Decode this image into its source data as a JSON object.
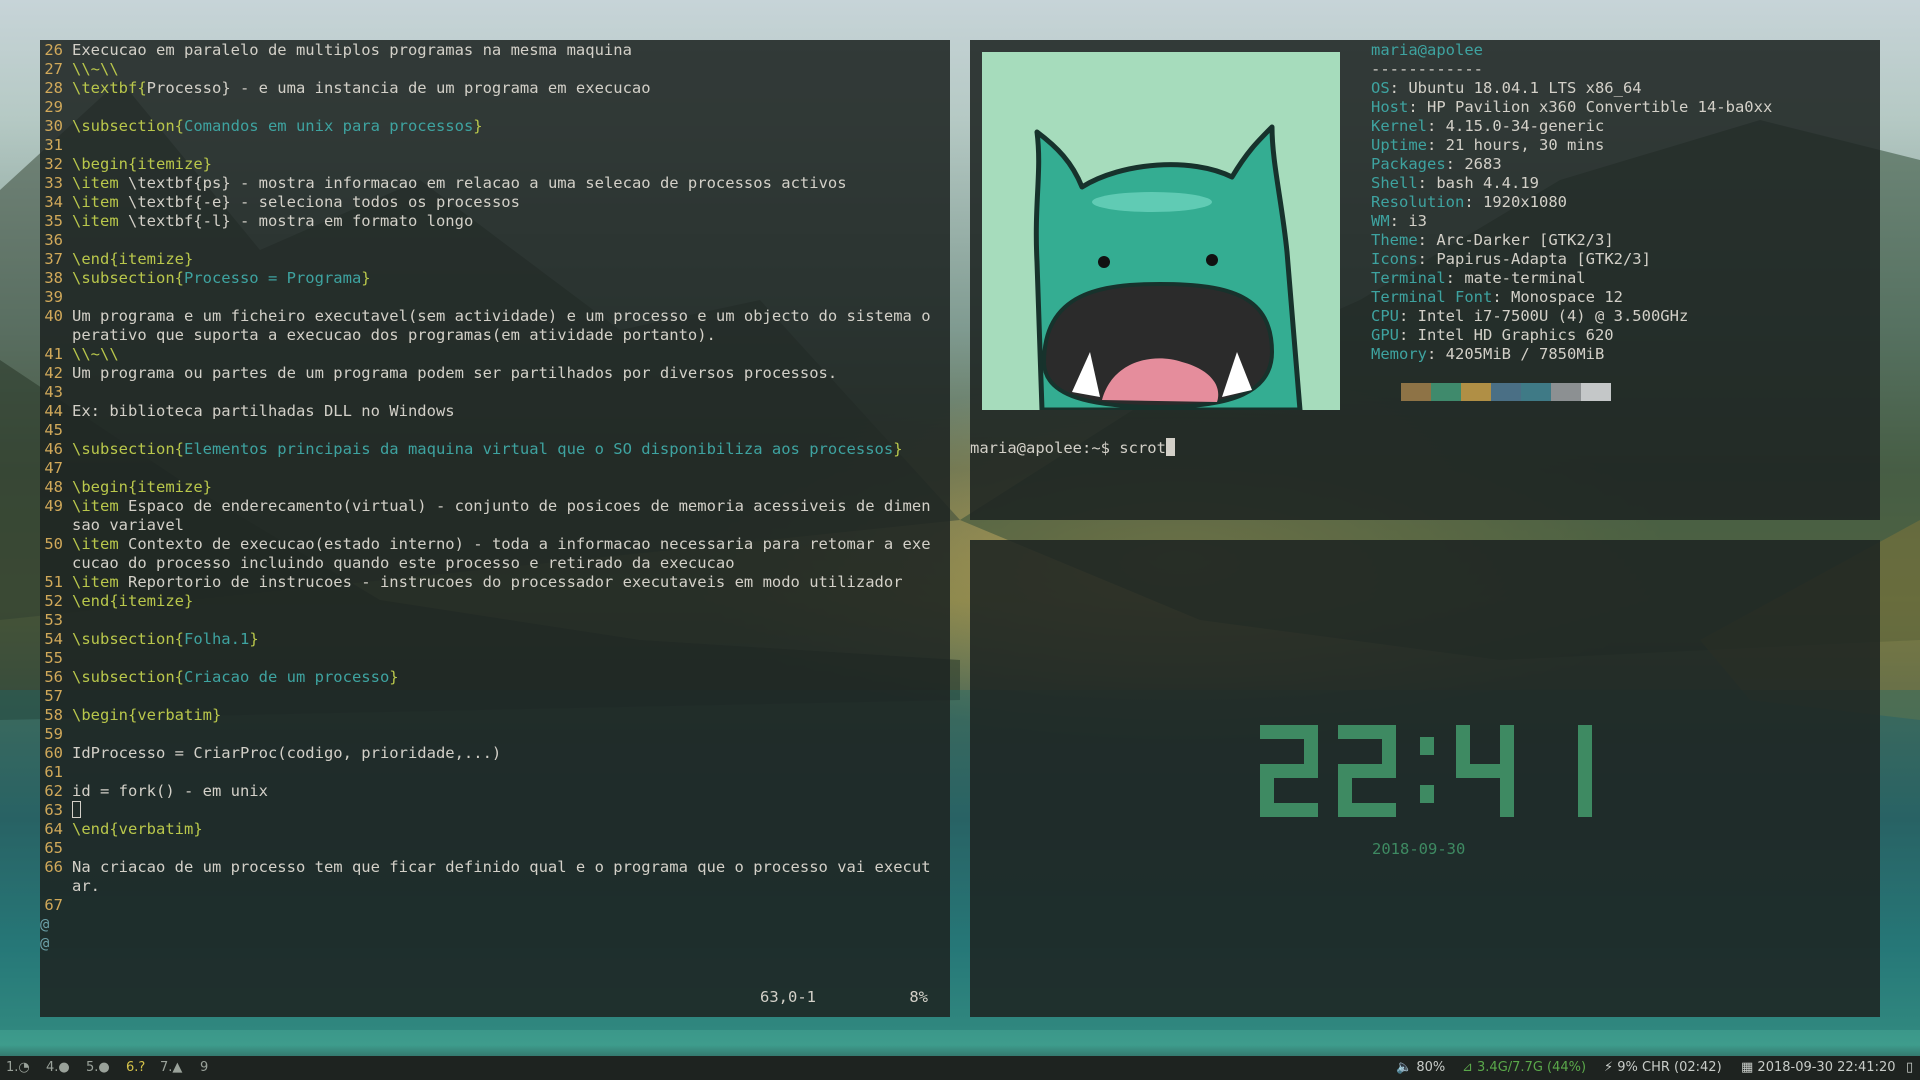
{
  "vim": {
    "lines": [
      {
        "n": "26",
        "t": "Execucao em paralelo de multiplos programas na mesma maquina"
      },
      {
        "n": "27",
        "t": "\\\\~\\\\",
        "cls": "kw"
      },
      {
        "n": "28",
        "parts": [
          [
            "\\textbf{",
            "kw"
          ],
          [
            "Processo",
            ""
          ],
          [
            "} - e uma instancia de um programa em execucao",
            ""
          ]
        ]
      },
      {
        "n": "29",
        "t": ""
      },
      {
        "n": "30",
        "parts": [
          [
            "\\subsection{",
            "kw"
          ],
          [
            "Comandos em unix para processos",
            "sec"
          ],
          [
            "}",
            "kw"
          ]
        ]
      },
      {
        "n": "31",
        "t": ""
      },
      {
        "n": "32",
        "parts": [
          [
            "\\begin{",
            "kw"
          ],
          [
            "itemize",
            "cmd"
          ],
          [
            "}",
            "kw"
          ]
        ]
      },
      {
        "n": "33",
        "parts": [
          [
            "\\item",
            "kw"
          ],
          [
            " \\textbf{",
            ""
          ],
          [
            "ps",
            ""
          ],
          [
            "} - mostra informacao em relacao a uma selecao de processos activos",
            ""
          ]
        ]
      },
      {
        "n": "34",
        "parts": [
          [
            "\\item",
            "kw"
          ],
          [
            " \\textbf{-e} - seleciona todos os processos",
            ""
          ]
        ]
      },
      {
        "n": "35",
        "parts": [
          [
            "\\item",
            "kw"
          ],
          [
            " \\textbf{-l} - mostra em formato longo",
            ""
          ]
        ]
      },
      {
        "n": "36",
        "t": ""
      },
      {
        "n": "37",
        "parts": [
          [
            "\\end{",
            "kw"
          ],
          [
            "itemize",
            "cmd"
          ],
          [
            "}",
            "kw"
          ]
        ]
      },
      {
        "n": "38",
        "parts": [
          [
            "\\subsection{",
            "kw"
          ],
          [
            "Processo = Programa",
            "sec"
          ],
          [
            "}",
            "kw"
          ]
        ]
      },
      {
        "n": "39",
        "t": ""
      },
      {
        "n": "40",
        "t": "Um programa e um ficheiro executavel(sem actividade) e um processo e um objecto do sistema operativo que suporta a execucao dos programas(em atividade portanto)."
      },
      {
        "n": "41",
        "t": "\\\\~\\\\",
        "cls": "kw"
      },
      {
        "n": "42",
        "t": "Um programa ou partes de um programa podem ser partilhados por diversos processos."
      },
      {
        "n": "43",
        "t": ""
      },
      {
        "n": "44",
        "t": "Ex: biblioteca partilhadas DLL no Windows"
      },
      {
        "n": "45",
        "t": ""
      },
      {
        "n": "46",
        "parts": [
          [
            "\\subsection{",
            "kw"
          ],
          [
            "Elementos principais da maquina virtual que o SO disponibiliza aos processos",
            "sec"
          ],
          [
            "}",
            "kw"
          ]
        ]
      },
      {
        "n": "47",
        "t": ""
      },
      {
        "n": "48",
        "parts": [
          [
            "\\begin{",
            "kw"
          ],
          [
            "itemize",
            "cmd"
          ],
          [
            "}",
            "kw"
          ]
        ]
      },
      {
        "n": "49",
        "parts": [
          [
            "\\item",
            "kw"
          ],
          [
            " Espaco de enderecamento(virtual) - conjunto de posicoes de memoria acessiveis de dimensao variavel",
            ""
          ]
        ]
      },
      {
        "n": "50",
        "parts": [
          [
            "\\item",
            "kw"
          ],
          [
            " Contexto de execucao(estado interno) - toda a informacao necessaria para retomar a execucao do processo incluindo quando este processo e retirado da execucao",
            ""
          ]
        ]
      },
      {
        "n": "51",
        "parts": [
          [
            "\\item",
            "kw"
          ],
          [
            " Reportorio de instrucoes - instrucoes do processador executaveis em modo utilizador",
            ""
          ]
        ]
      },
      {
        "n": "52",
        "parts": [
          [
            "\\end{",
            "kw"
          ],
          [
            "itemize",
            "cmd"
          ],
          [
            "}",
            "kw"
          ]
        ]
      },
      {
        "n": "53",
        "t": ""
      },
      {
        "n": "54",
        "parts": [
          [
            "\\subsection{",
            "kw"
          ],
          [
            "Folha.1",
            "sec"
          ],
          [
            "}",
            "kw"
          ]
        ]
      },
      {
        "n": "55",
        "t": ""
      },
      {
        "n": "56",
        "parts": [
          [
            "\\subsection{",
            "kw"
          ],
          [
            "Criacao de um processo",
            "sec"
          ],
          [
            "}",
            "kw"
          ]
        ]
      },
      {
        "n": "57",
        "t": ""
      },
      {
        "n": "58",
        "parts": [
          [
            "\\begin{",
            "kw"
          ],
          [
            "verbatim",
            "cmd"
          ],
          [
            "}",
            "kw"
          ]
        ]
      },
      {
        "n": "59",
        "t": ""
      },
      {
        "n": "60",
        "t": "IdProcesso = CriarProc(codigo, prioridade,...)"
      },
      {
        "n": "61",
        "t": ""
      },
      {
        "n": "62",
        "t": "id = fork() - em unix"
      },
      {
        "n": "63",
        "t": "",
        "cursor": true
      },
      {
        "n": "64",
        "parts": [
          [
            "\\end{",
            "kw"
          ],
          [
            "verbatim",
            "cmd"
          ],
          [
            "}",
            "kw"
          ]
        ]
      },
      {
        "n": "65",
        "t": ""
      },
      {
        "n": "66",
        "t": "Na criacao de um processo tem que ficar definido qual e o programa que o processo vai executar."
      },
      {
        "n": "67",
        "t": ""
      }
    ],
    "tildes": [
      "@",
      "@"
    ],
    "status_pos": "63,0-1",
    "status_pct": "8%"
  },
  "neofetch": {
    "user_host": "maria@apolee",
    "separator": "------------",
    "fields": [
      {
        "k": "OS",
        "v": "Ubuntu 18.04.1 LTS x86_64"
      },
      {
        "k": "Host",
        "v": "HP Pavilion x360 Convertible 14-ba0xx"
      },
      {
        "k": "Kernel",
        "v": "4.15.0-34-generic"
      },
      {
        "k": "Uptime",
        "v": "21 hours, 30 mins"
      },
      {
        "k": "Packages",
        "v": "2683"
      },
      {
        "k": "Shell",
        "v": "bash 4.4.19"
      },
      {
        "k": "Resolution",
        "v": "1920x1080"
      },
      {
        "k": "WM",
        "v": "i3"
      },
      {
        "k": "Theme",
        "v": "Arc-Darker [GTK2/3]"
      },
      {
        "k": "Icons",
        "v": "Papirus-Adapta [GTK2/3]"
      },
      {
        "k": "Terminal",
        "v": "mate-terminal"
      },
      {
        "k": "Terminal Font",
        "v": "Monospace 12"
      },
      {
        "k": "CPU",
        "v": "Intel i7-7500U (4) @ 3.500GHz"
      },
      {
        "k": "GPU",
        "v": "Intel HD Graphics 620"
      },
      {
        "k": "Memory",
        "v": "4205MiB / 7850MiB"
      }
    ],
    "palette": [
      "#8e7346",
      "#3f8a6c",
      "#b08f45",
      "#4a6f85",
      "#3f7a86",
      "#8c9092",
      "#c4c7c8"
    ],
    "prompt": "maria@apolee:~$ scrot"
  },
  "clock": {
    "time": "22:41",
    "date": "2018-09-30",
    "color": "#3e8a62"
  },
  "bar": {
    "workspaces": [
      {
        "num": "1.",
        "icon": "◔",
        "active": false
      },
      {
        "num": "4.",
        "icon": "●",
        "active": false
      },
      {
        "num": "5.",
        "icon": "●",
        "active": false
      },
      {
        "num": "6.",
        "icon": "?",
        "active": true
      },
      {
        "num": "7.",
        "icon": "▲",
        "active": false
      },
      {
        "num": "9",
        "icon": "",
        "active": false
      }
    ],
    "volume": "80%",
    "wifi": "3.4G/7.7G (44%)",
    "battery": "9% CHR (02:42)",
    "datetime": "2018-09-30 22:41:20",
    "wifi_color": "#5aa84a"
  }
}
